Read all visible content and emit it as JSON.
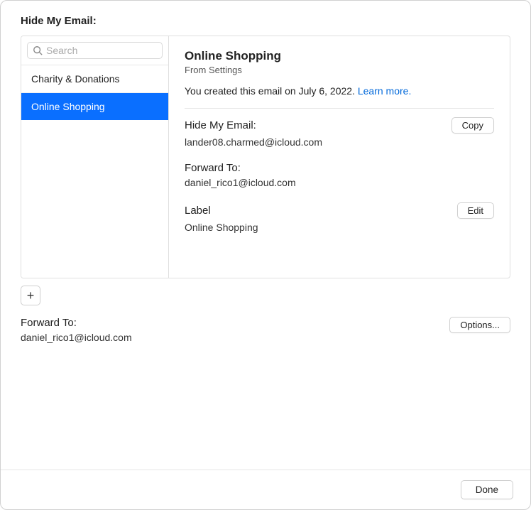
{
  "window": {
    "title": "Hide My Email:"
  },
  "search": {
    "placeholder": "Search"
  },
  "sidebar": {
    "items": [
      {
        "label": "Charity & Donations",
        "selected": false
      },
      {
        "label": "Online Shopping",
        "selected": true
      }
    ]
  },
  "detail": {
    "title": "Online Shopping",
    "subtitle": "From Settings",
    "created_text": "You created this email on July 6, 2022. ",
    "learn_more": "Learn more.",
    "hide_my_email": {
      "label": "Hide My Email:",
      "value": "lander08.charmed@icloud.com",
      "copy_button": "Copy"
    },
    "forward_to": {
      "label": "Forward To:",
      "value": "daniel_rico1@icloud.com"
    },
    "label_section": {
      "label": "Label",
      "value": "Online Shopping",
      "edit_button": "Edit"
    }
  },
  "global_forward": {
    "label": "Forward To:",
    "value": "daniel_rico1@icloud.com",
    "options_button": "Options..."
  },
  "footer": {
    "done_button": "Done"
  }
}
